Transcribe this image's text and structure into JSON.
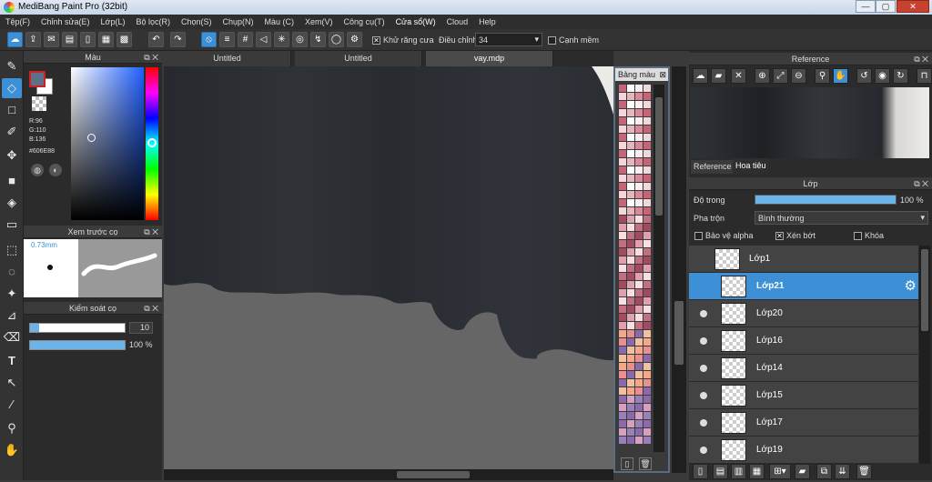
{
  "app": {
    "title": "MediBang Paint Pro (32bit)",
    "minimize": "—",
    "maximize": "▢",
    "close": "✕"
  },
  "menu": [
    "Tệp(F)",
    "Chỉnh sửa(E)",
    "Lớp(L)",
    "Bộ lọc(R)",
    "Chọn(S)",
    "Chụp(N)",
    "Màu (C)",
    "Xem(V)",
    "Công cụ(T)",
    "Cửa sổ(W)",
    "Cloud",
    "Help"
  ],
  "toolbar": {
    "antialias_label": "Khử răng cưa",
    "adjust_label": "Điều chỉnh",
    "adjust_value": "34",
    "soft_edge_label": "Cạnh mềm"
  },
  "color_panel": {
    "title": "Màu",
    "r": "R:96",
    "g": "G:110",
    "b": "B:136",
    "hex": "#606E88",
    "fg_color": "#606E88"
  },
  "brush_preview": {
    "title": "Xem trước cọ",
    "size": "0.73mm"
  },
  "brush_control": {
    "title": "Kiểm soát cọ",
    "size_value": "10",
    "opacity_value": "100 %",
    "size_fraction": 0.1,
    "opacity_fraction": 1.0
  },
  "tabs": [
    "Untitled",
    "Untitled",
    "vay.mdp"
  ],
  "palette": {
    "title": "Bảng màu"
  },
  "reference": {
    "title": "Reference",
    "tab1": "Reference",
    "tab2": "Hoa tiêu"
  },
  "layers": {
    "title": "Lớp",
    "opacity_label": "Độ trong",
    "opacity_value": "100 %",
    "opacity_fraction": 1.0,
    "blend_label": "Pha trộn",
    "blend_value": "Bình thường",
    "protect_alpha": "Bảo vệ alpha",
    "clipping": "Xén bớt",
    "lock": "Khóa",
    "items": [
      "Lớp1",
      "Lớp21",
      "Lớp20",
      "Lớp16",
      "Lớp14",
      "Lớp15",
      "Lớp17",
      "Lớp19"
    ],
    "selected": "Lớp21"
  }
}
